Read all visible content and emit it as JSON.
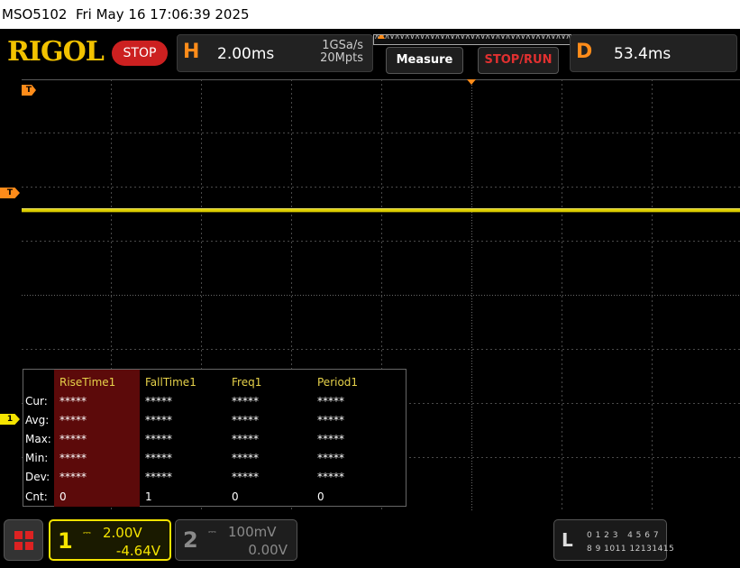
{
  "titlebar": {
    "text": "MSO5102  Fri May 16 17:06:39 2025"
  },
  "header": {
    "logo": "RIGOL",
    "status": "STOP",
    "horizontal": {
      "letter": "H",
      "timebase": "2.00ms",
      "sample_rate": "1GSa/s",
      "memory_depth": "20Mpts"
    },
    "measure_button": "Measure",
    "stoprun_button": "STOP/RUN",
    "delay": {
      "letter": "D",
      "value": "53.4ms"
    }
  },
  "markers": {
    "trigger_top": "T",
    "trigger_level": "T",
    "ch1": "1"
  },
  "measure_panel": {
    "columns": [
      "RiseTime1",
      "FallTime1",
      "Freq1",
      "Period1"
    ],
    "rows": [
      {
        "label": "Cur:",
        "values": [
          "*****",
          "*****",
          "*****",
          "*****"
        ]
      },
      {
        "label": "Avg:",
        "values": [
          "*****",
          "*****",
          "*****",
          "*****"
        ]
      },
      {
        "label": "Max:",
        "values": [
          "*****",
          "*****",
          "*****",
          "*****"
        ]
      },
      {
        "label": "Min:",
        "values": [
          "*****",
          "*****",
          "*****",
          "*****"
        ]
      },
      {
        "label": "Dev:",
        "values": [
          "*****",
          "*****",
          "*****",
          "*****"
        ]
      },
      {
        "label": "Cnt:",
        "values": [
          "0",
          "1",
          "0",
          "0"
        ]
      }
    ]
  },
  "channels": [
    {
      "number": "1",
      "coupling": "⎓",
      "scale": "2.00V",
      "offset": "-4.64V",
      "color": "#f5e400",
      "active": true
    },
    {
      "number": "2",
      "coupling": "⎓",
      "scale": "100mV",
      "offset": "0.00V",
      "color": "#8a8a8a",
      "active": false
    }
  ],
  "logic": {
    "label": "L",
    "row1": "0 1 2 3   4 5 6 7",
    "row2": "8 9 1011 12131415"
  },
  "icons": {
    "home": "grid-menu-icon"
  },
  "colors": {
    "ch1": "#f5e400",
    "trigger": "#ff8c1a",
    "stop": "#cc2020",
    "logo": "#f2c200"
  }
}
